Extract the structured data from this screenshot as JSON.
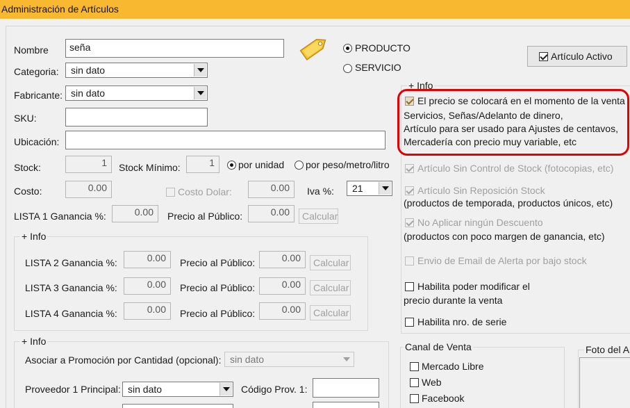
{
  "window": {
    "title": "Administración de Artículos"
  },
  "form": {
    "nombre": {
      "label": "Nombre",
      "value": "seña"
    },
    "categoria": {
      "label": "Categoria:",
      "value": "sin dato"
    },
    "fabricante": {
      "label": "Fabricante:",
      "value": "sin dato"
    },
    "sku": {
      "label": "SKU:",
      "value": ""
    },
    "ubicacion": {
      "label": "Ubicación:",
      "value": ""
    },
    "tipo": {
      "producto": "PRODUCTO",
      "servicio": "SERVICIO",
      "selected": "PRODUCTO"
    },
    "articulo_activo": {
      "label": "Artículo Activo",
      "checked": true
    },
    "stock": {
      "label": "Stock:",
      "value": "1"
    },
    "stock_minimo": {
      "label": "Stock Mínimo:",
      "value": "1"
    },
    "por_unidad": "por unidad",
    "por_peso": "por peso/metro/litro",
    "costo": {
      "label": "Costo:",
      "value": "0.00"
    },
    "costo_dolar": {
      "label": "Costo Dolar:",
      "value": "0.00"
    },
    "iva": {
      "label": "Iva %:",
      "value": "21"
    },
    "lista1": {
      "label": "LISTA 1 Ganancia %:",
      "ganancia": "0.00",
      "precio_label": "Precio al Público:",
      "precio": "0.00",
      "calcular": "Calcular"
    }
  },
  "info_listas": {
    "title": "+ Info",
    "rows": [
      {
        "label": "LISTA 2 Ganancia %:",
        "ganancia": "0.00",
        "precio_label": "Precio al Público:",
        "precio": "0.00",
        "calcular": "Calcular"
      },
      {
        "label": "LISTA 3 Ganancia %:",
        "ganancia": "0.00",
        "precio_label": "Precio al Público:",
        "precio": "0.00",
        "calcular": "Calcular"
      },
      {
        "label": "LISTA 4 Ganancia %:",
        "ganancia": "0.00",
        "precio_label": "Precio al Público:",
        "precio": "0.00",
        "calcular": "Calcular"
      }
    ]
  },
  "info_promo": {
    "title": "+ Info",
    "promo_label": "Asociar a Promoción por Cantidad (opcional):",
    "promo_value": "sin dato",
    "proveedor_label": "Proveedor 1 Principal:",
    "proveedor_value": "sin dato",
    "codigo_label": "Código Prov. 1:",
    "codigo_value": ""
  },
  "info_right": {
    "title": "+ Info",
    "precio_venta": {
      "line1": "El precio se colocará en el momento de la venta",
      "line2": "Servicios, Señas/Adelanto de dinero,",
      "line3": "Artículo para ser usado para Ajustes de centavos,",
      "line4": "Mercadería con precio muy variable, etc"
    },
    "sin_control": "Artículo Sin Control de Stock (fotocopias, etc)",
    "sin_reposicion": "Artículo Sin Reposición Stock",
    "sin_reposicion_sub": "(productos de temporada, productos únicos, etc)",
    "no_descuento": "No Aplicar ningún Descuento",
    "no_descuento_sub": "(productos con poco margen de ganancia, etc)",
    "email_alerta": "Envio de Email de Alerta por bajo stock",
    "modificar_precio_1": "Habilita poder modificar el",
    "modificar_precio_2": "precio durante la venta",
    "nro_serie": "Habilita nro. de serie"
  },
  "canal": {
    "title": "Canal de Venta",
    "items": [
      "Mercado Libre",
      "Web",
      "Facebook"
    ]
  },
  "foto": {
    "title": "Foto del Ar"
  },
  "colors": {
    "titlebar": "#f8b830",
    "highlight": "#e30000"
  },
  "icons": [
    "price-tag-icon"
  ]
}
